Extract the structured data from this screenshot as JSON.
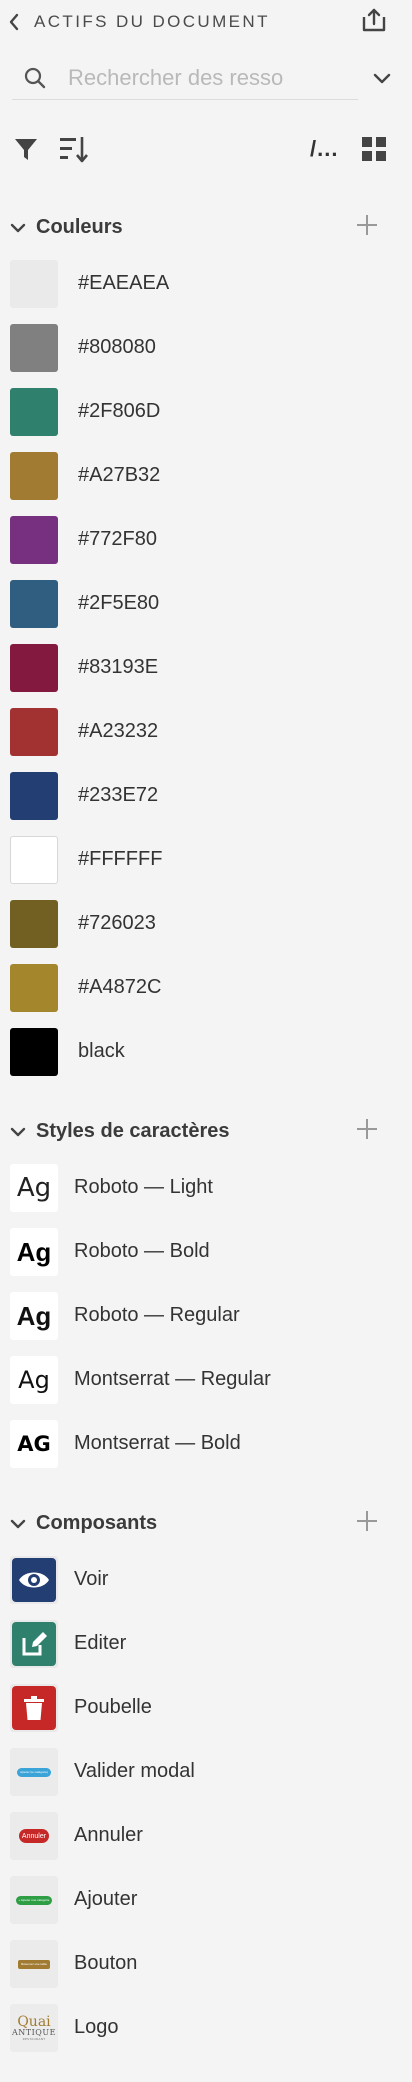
{
  "header": {
    "title": "ACTIFS DU DOCUMENT",
    "back_icon": "chevron-left-icon",
    "share_icon": "share-upload-icon"
  },
  "search": {
    "placeholder": "Rechercher des resso",
    "value": ""
  },
  "toolbar": {
    "path_label": "/..."
  },
  "sections": {
    "colors": {
      "title": "Couleurs",
      "items": [
        {
          "label": "#EAEAEA",
          "color": "#EAEAEA"
        },
        {
          "label": "#808080",
          "color": "#808080"
        },
        {
          "label": "#2F806D",
          "color": "#2F806D"
        },
        {
          "label": "#A27B32",
          "color": "#A27B32"
        },
        {
          "label": "#772F80",
          "color": "#772F80"
        },
        {
          "label": "#2F5E80",
          "color": "#2F5E80"
        },
        {
          "label": "#83193E",
          "color": "#83193E"
        },
        {
          "label": "#A23232",
          "color": "#A23232"
        },
        {
          "label": "#233E72",
          "color": "#233E72"
        },
        {
          "label": "#FFFFFF",
          "color": "#FFFFFF"
        },
        {
          "label": "#726023",
          "color": "#726023"
        },
        {
          "label": "#A4872C",
          "color": "#A4872C"
        },
        {
          "label": "black",
          "color": "#000000"
        }
      ]
    },
    "char_styles": {
      "title": "Styles de caractères",
      "items": [
        {
          "label": "Roboto — Light",
          "sample": "Ag"
        },
        {
          "label": "Roboto — Bold",
          "sample": "Ag"
        },
        {
          "label": "Roboto — Regular",
          "sample": "Ag"
        },
        {
          "label": "Montserrat — Regular",
          "sample": "Ag"
        },
        {
          "label": "Montserrat — Bold",
          "sample": "AG"
        }
      ]
    },
    "components": {
      "title": "Composants",
      "items": [
        {
          "label": "Voir",
          "icon": "eye-icon",
          "color": "#233E72"
        },
        {
          "label": "Editer",
          "icon": "edit-icon",
          "color": "#2F806D"
        },
        {
          "label": "Poubelle",
          "icon": "trash-icon",
          "color": "#C62828"
        },
        {
          "label": "Valider modal",
          "color": "#3AA3D8",
          "pill_text": "Ajouter (le catégorie)"
        },
        {
          "label": "Annuler",
          "color": "#C62828",
          "pill_text": "Annuler"
        },
        {
          "label": "Ajouter",
          "color": "#2E9E45",
          "pill_text": "+ Ajouter une catégorie"
        },
        {
          "label": "Bouton",
          "color": "#A27B32",
          "pill_text": "Réservez une table"
        },
        {
          "label": "Logo",
          "logo_line1": "Quai",
          "logo_line2": "ANTIQUE",
          "logo_line3": "RESTAURANT"
        }
      ]
    }
  }
}
